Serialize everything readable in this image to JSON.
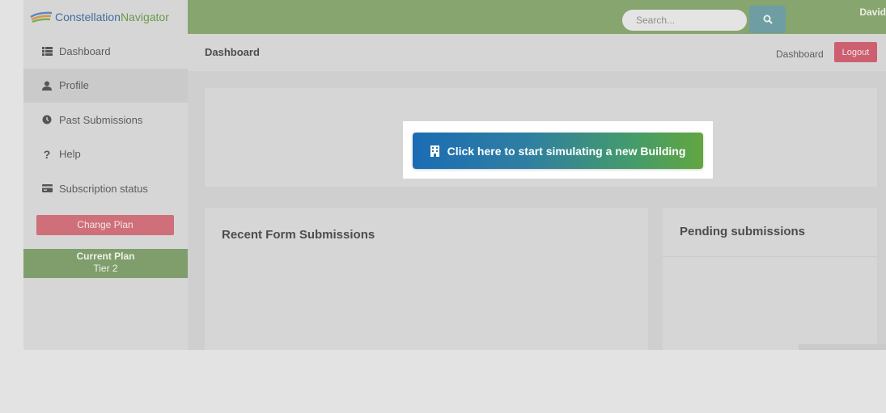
{
  "brand": {
    "name_main": "Constellation",
    "name_accent": "Navigator",
    "logo_icon": "constellation-logo"
  },
  "sidebar": {
    "items": [
      {
        "label": "Dashboard",
        "icon": "list-icon",
        "active": false
      },
      {
        "label": "Profile",
        "icon": "user-icon",
        "active": true
      },
      {
        "label": "Past Submissions",
        "icon": "clock-icon",
        "active": false
      },
      {
        "label": "Help",
        "icon": "question-icon",
        "active": false
      },
      {
        "label": "Subscription status",
        "icon": "credit-card-icon",
        "active": false
      }
    ],
    "change_plan_label": "Change Plan",
    "plan": {
      "title": "Current Plan",
      "tier": "Tier 2"
    }
  },
  "topbar": {
    "search_placeholder": "Search...",
    "search_icon": "search-icon",
    "user_name": "David"
  },
  "header": {
    "title": "Dashboard",
    "breadcrumb": "Dashboard",
    "logout_label": "Logout"
  },
  "main": {
    "start_button_label": "Click here to start simulating a new Building",
    "start_button_icon": "building-icon",
    "recent_title": "Recent Form Submissions",
    "pending_title": "Pending submissions"
  },
  "colors": {
    "topbar": "#87a56f",
    "logout": "#cd6070",
    "change_plan": "#cf6f7a",
    "plan_box": "#7f9e6c",
    "button_gradient_start": "#1b6cb4",
    "button_gradient_end": "#62a640"
  }
}
